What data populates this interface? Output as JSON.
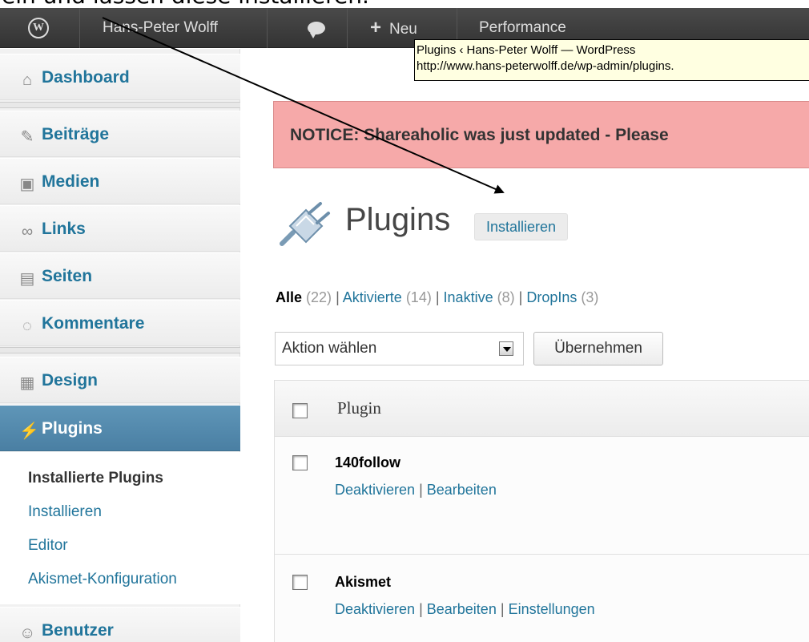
{
  "caption": "ein und lassen diese installieren.",
  "adminbar": {
    "site_name": "Hans-Peter Wolff",
    "new_label": "Neu",
    "performance_label": "Performance"
  },
  "tooltip": {
    "line1": "Plugins ‹ Hans-Peter Wolff — WordPress",
    "line2": "http://www.hans-peterwolff.de/wp-admin/plugins."
  },
  "sidebar": {
    "items": [
      {
        "label": "Dashboard",
        "icon": "home-icon"
      },
      {
        "label": "Beiträge",
        "icon": "pin-icon"
      },
      {
        "label": "Medien",
        "icon": "media-icon"
      },
      {
        "label": "Links",
        "icon": "link-icon"
      },
      {
        "label": "Seiten",
        "icon": "pages-icon"
      },
      {
        "label": "Kommentare",
        "icon": "comment-icon"
      },
      {
        "label": "Design",
        "icon": "design-icon"
      },
      {
        "label": "Plugins",
        "icon": "plug-icon"
      },
      {
        "label": "Benutzer",
        "icon": "users-icon"
      }
    ],
    "submenu": [
      "Installierte Plugins",
      "Installieren",
      "Editor",
      "Akismet-Konfiguration"
    ]
  },
  "notice": {
    "text": "NOTICE: Shareaholic was just updated - Please"
  },
  "page": {
    "title": "Plugins",
    "add_new": "Installieren"
  },
  "filters": {
    "all_label": "Alle",
    "all_count": "(22)",
    "active_label": "Aktivierte",
    "active_count": "(14)",
    "inactive_label": "Inaktive",
    "inactive_count": "(8)",
    "dropins_label": "DropIns",
    "dropins_count": "(3)",
    "separator": "|"
  },
  "bulk": {
    "selected": "Aktion wählen",
    "apply": "Übernehmen"
  },
  "table": {
    "header": "Plugin",
    "rows": [
      {
        "name": "140follow",
        "actions": [
          "Deaktivieren",
          "Bearbeiten"
        ]
      },
      {
        "name": "Akismet",
        "actions": [
          "Deaktivieren",
          "Bearbeiten",
          "Einstellungen"
        ]
      }
    ]
  },
  "colors": {
    "admin_bar": "#333333",
    "link": "#21759b",
    "active_menu": "#4a7fa3",
    "notice_bg": "#f6a9a9"
  }
}
